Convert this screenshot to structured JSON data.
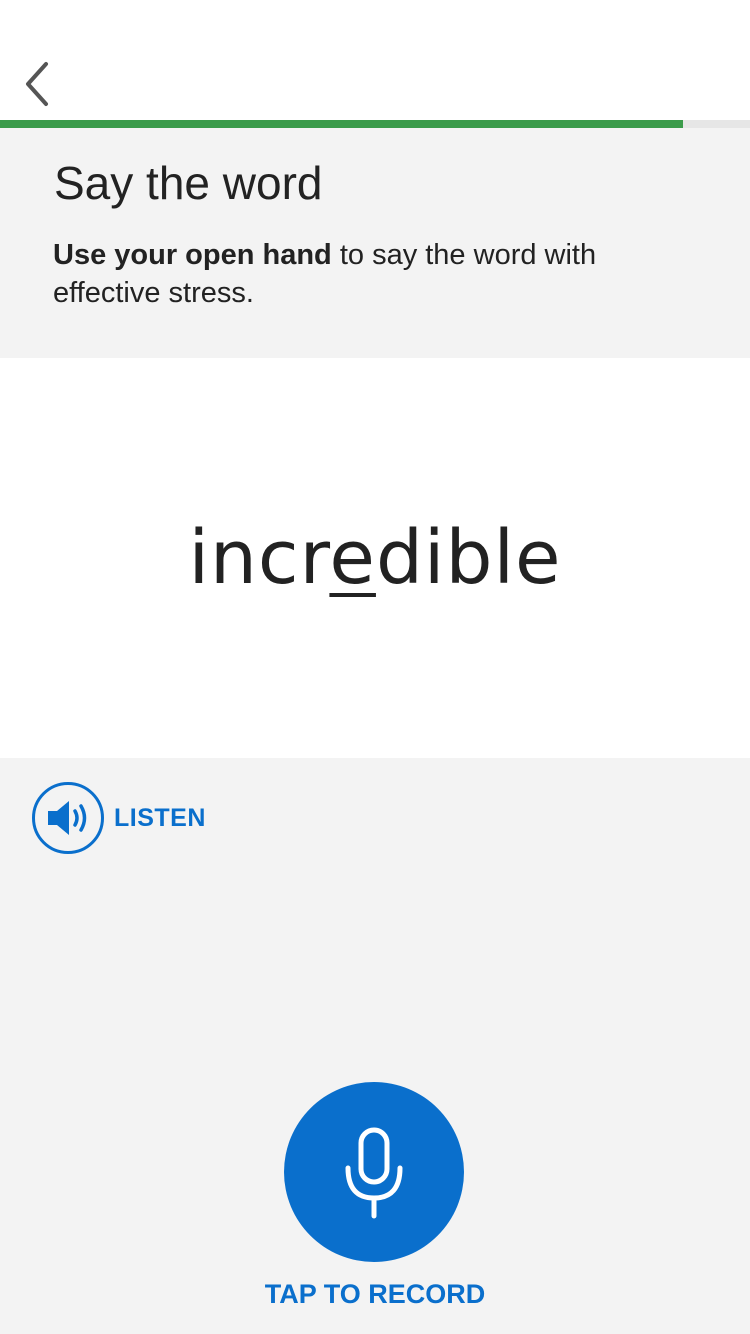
{
  "header": {
    "back_icon": "chevron-left-icon",
    "progress_fraction": 0.91
  },
  "instructions": {
    "title": "Say the word",
    "description_bold": "Use your open hand",
    "description_rest": " to say the word with effective stress."
  },
  "word": {
    "before_stress": "incr",
    "stressed": "e",
    "after_stress": "dible"
  },
  "listen": {
    "icon": "speaker-icon",
    "label": "LISTEN"
  },
  "record": {
    "icon": "microphone-icon",
    "label": "TAP TO RECORD"
  },
  "colors": {
    "accent_blue": "#0a6fcc",
    "progress_green": "#3b9b4a",
    "panel_gray": "#f3f3f3"
  }
}
